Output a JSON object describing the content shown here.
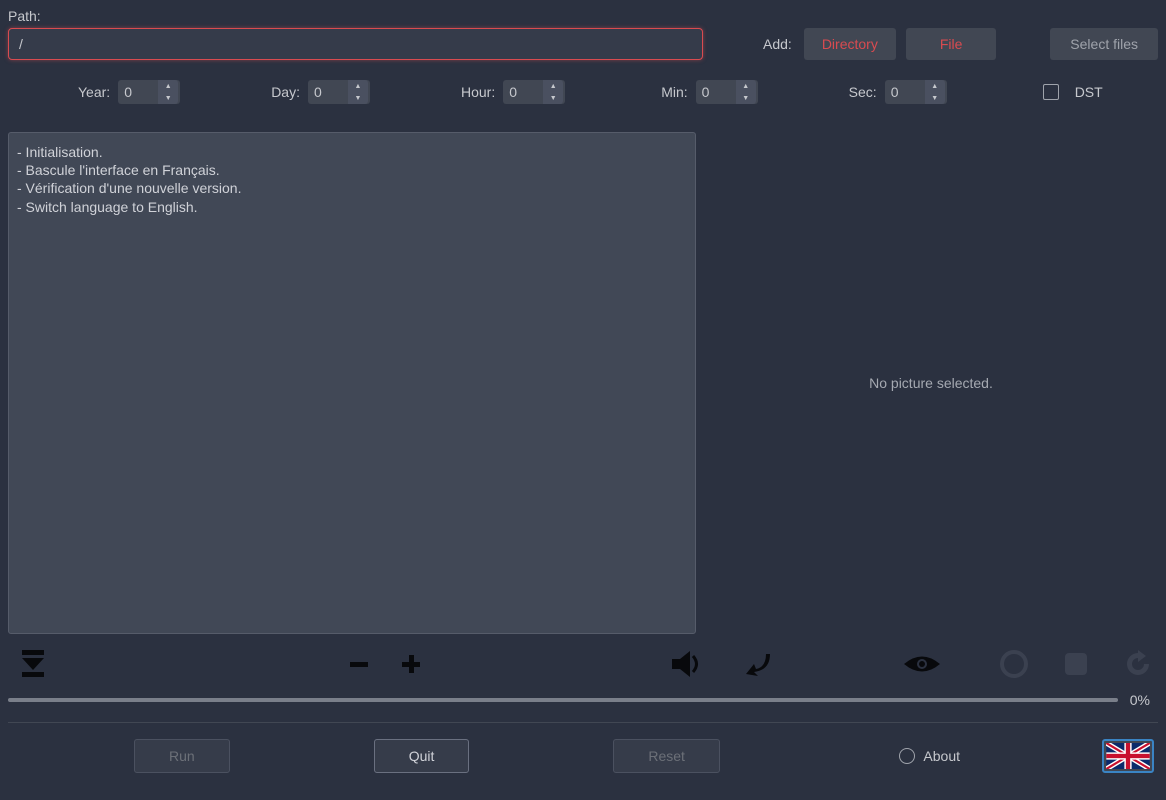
{
  "path": {
    "label": "Path:",
    "value": "/"
  },
  "add": {
    "label": "Add:",
    "directory": "Directory",
    "file": "File",
    "select_files": "Select files"
  },
  "spin": {
    "year_label": "Year:",
    "year_value": "0",
    "day_label": "Day:",
    "day_value": "0",
    "hour_label": "Hour:",
    "hour_value": "0",
    "min_label": "Min:",
    "min_value": "0",
    "sec_label": "Sec:",
    "sec_value": "0",
    "dst_label": "DST"
  },
  "log": {
    "l0": "- Initialisation.",
    "l1": "- Bascule l'interface en Français.",
    "l2": "- Vérification d'une nouvelle version.",
    "l3": "- Switch language to English."
  },
  "preview": {
    "empty": "No picture selected."
  },
  "progress": {
    "text": "0%"
  },
  "buttons": {
    "run": "Run",
    "quit": "Quit",
    "reset": "Reset",
    "about": "About"
  }
}
